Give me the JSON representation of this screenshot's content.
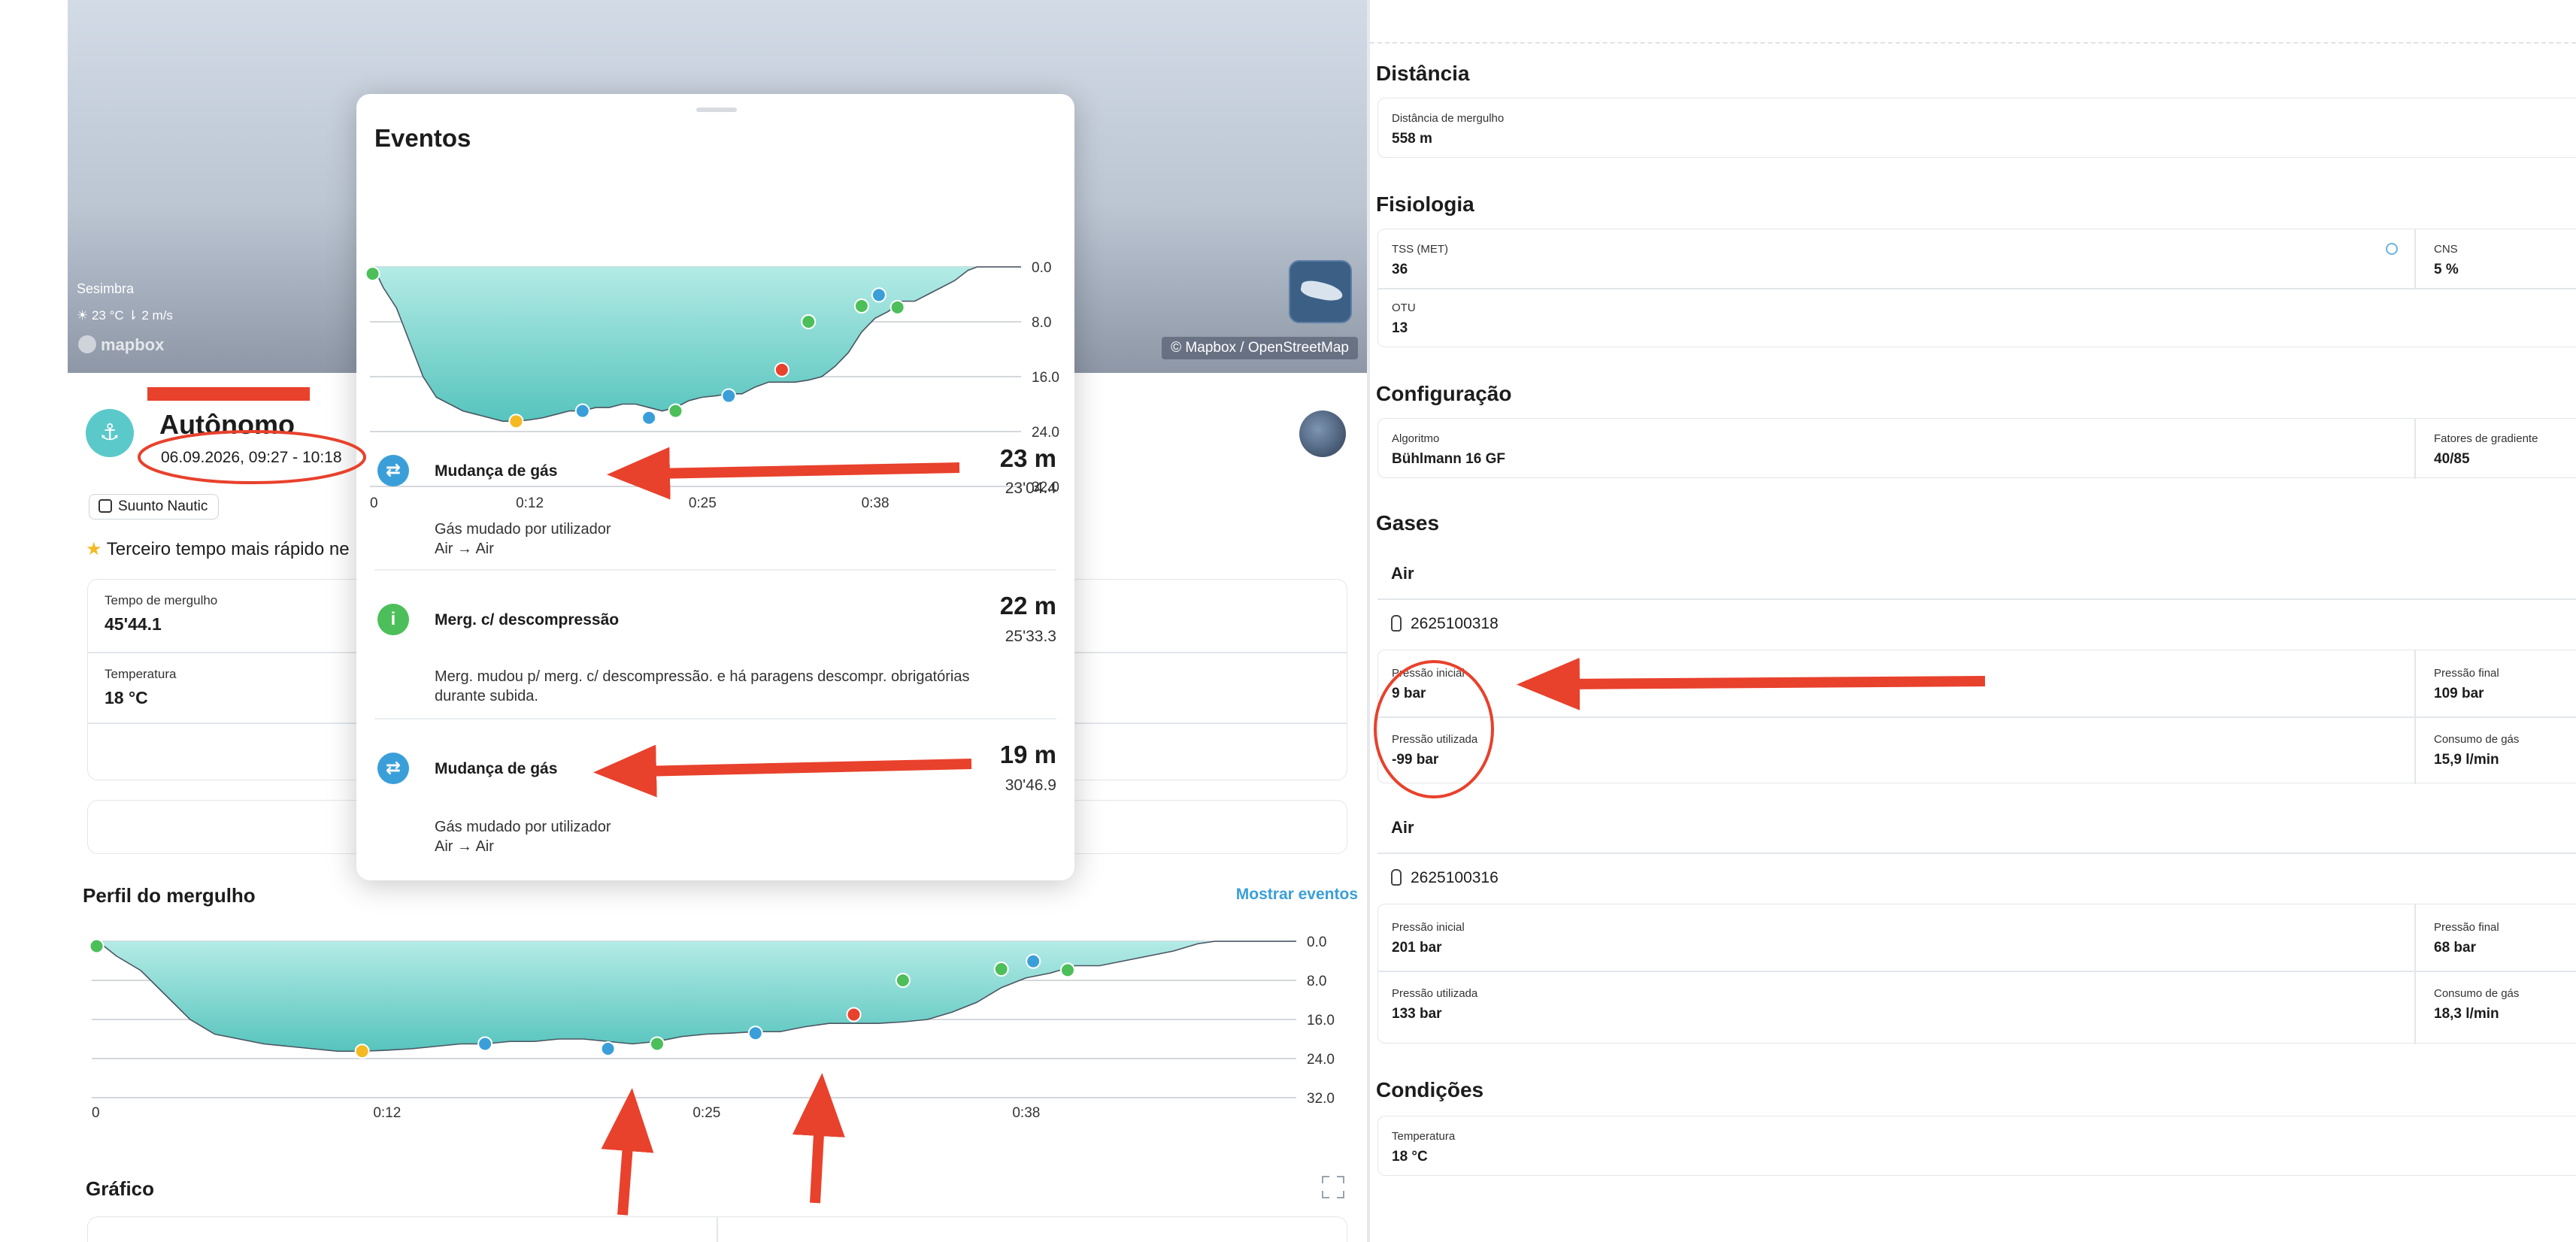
{
  "map": {
    "location": "Sesimbra",
    "weather": "☀ 23 °C  ⇂ 2 m/s",
    "logo": "mapbox",
    "attribution": "© Mapbox / OpenStreetMap"
  },
  "activity": {
    "title": "Autônomo",
    "datetime": "06.09.2026, 09:27 - 10:18",
    "device": "Suunto Nautic",
    "achievement": "Terceiro tempo mais rápido ne"
  },
  "stats": [
    {
      "label": "Tempo de mergulho",
      "value": "45'44.1"
    },
    {
      "label": "Temperatura",
      "value": "18 °C"
    }
  ],
  "profile": {
    "title": "Perfil do mergulho",
    "show_events": "Mostrar eventos",
    "y_ticks": [
      "0.0",
      "8.0",
      "16.0",
      "24.0",
      "32.0"
    ],
    "x_ticks": [
      "0",
      "0:12",
      "0:25",
      "0:38"
    ]
  },
  "graph_title": "Gráfico",
  "chart_data": {
    "type": "area",
    "x_unit": "minutes",
    "y_unit": "m (depth, inverted axis)",
    "ylim": [
      0,
      32
    ],
    "y_ticks": [
      0,
      8,
      16,
      24,
      32
    ],
    "x_ticks": [
      "0",
      "0:12",
      "0:25",
      "0:38"
    ],
    "x": [
      0,
      0.5,
      1,
      2,
      3,
      4,
      5,
      6,
      7,
      8,
      9,
      10,
      11,
      12,
      13,
      14,
      15,
      16,
      17,
      18,
      19,
      20,
      21,
      22,
      23,
      24,
      25,
      26,
      27,
      28,
      29,
      30,
      31,
      32,
      33,
      34,
      35,
      36,
      37,
      38,
      39,
      40,
      41,
      42,
      43,
      44,
      45,
      45.7,
      49
    ],
    "depth": [
      1,
      1,
      3,
      6,
      11,
      16,
      19,
      20,
      21,
      21.5,
      22,
      22.5,
      22.5,
      22.3,
      22,
      21.5,
      21,
      21,
      20.5,
      20.5,
      20,
      20,
      20.5,
      21,
      20.5,
      19.5,
      19,
      18.8,
      18.5,
      18.5,
      17.5,
      16.8,
      16.8,
      16.8,
      16.5,
      16,
      14.5,
      12.5,
      9.5,
      7.5,
      6.5,
      5,
      5,
      4,
      3,
      2,
      0.5,
      0,
      0
    ],
    "events": [
      {
        "x": 0.2,
        "depth": 1,
        "type": "start",
        "color": "#4cbf5a"
      },
      {
        "x": 11,
        "depth": 22.5,
        "type": "warning",
        "color": "#f5b922"
      },
      {
        "x": 16,
        "depth": 21,
        "type": "gas",
        "color": "#3a9fd9"
      },
      {
        "x": 21,
        "depth": 22,
        "type": "gas",
        "color": "#3a9fd9"
      },
      {
        "x": 23,
        "depth": 21,
        "type": "info",
        "color": "#4cbf5a"
      },
      {
        "x": 27,
        "depth": 18.8,
        "type": "gas",
        "color": "#3a9fd9"
      },
      {
        "x": 31,
        "depth": 15,
        "type": "alarm",
        "color": "#e8412c"
      },
      {
        "x": 33,
        "depth": 8,
        "type": "info",
        "color": "#4cbf5a"
      },
      {
        "x": 37,
        "depth": 5.7,
        "type": "info",
        "color": "#4cbf5a"
      },
      {
        "x": 38.3,
        "depth": 4.1,
        "type": "gas",
        "color": "#3a9fd9"
      },
      {
        "x": 39.7,
        "depth": 5.9,
        "type": "info",
        "color": "#4cbf5a"
      }
    ]
  },
  "events_modal": {
    "title": "Eventos",
    "items": [
      {
        "icon": "⇄",
        "color": "#3a9fd9",
        "title": "Mudança de gás",
        "depth": "23 m",
        "time": "23'04.4",
        "desc": "Gás mudado por utilizador\nAir → Air"
      },
      {
        "icon": "i",
        "color": "#4cbf5a",
        "title": "Merg. c/ descompressão",
        "depth": "22 m",
        "time": "25'33.3",
        "desc": "Merg. mudou p/ merg. c/ descompressão. e há paragens descompr. obrigatórias durante subida."
      },
      {
        "icon": "⇄",
        "color": "#3a9fd9",
        "title": "Mudança de gás",
        "depth": "19 m",
        "time": "30'46.9",
        "desc": "Gás mudado por utilizador\nAir → Air"
      }
    ]
  },
  "right": {
    "distance": {
      "title": "Distância",
      "label": "Distância de mergulho",
      "value": "558 m"
    },
    "physiology": {
      "title": "Fisiologia",
      "tss_label": "TSS (MET)",
      "tss_value": "36",
      "cns_label": "CNS",
      "cns_value": "5 %",
      "otu_label": "OTU",
      "otu_value": "13"
    },
    "config": {
      "title": "Configuração",
      "algo_label": "Algoritmo",
      "algo_value": "Bühlmann 16 GF",
      "gf_label": "Fatores de gradiente",
      "gf_value": "40/85"
    },
    "gases": {
      "title": "Gases",
      "tanks": [
        {
          "name": "Air",
          "tank_id": "2625100318",
          "start_label": "Pressão inicial",
          "start": "9 bar",
          "end_label": "Pressão final",
          "end": "109 bar",
          "used_label": "Pressão utilizada",
          "used": "-99 bar",
          "cons_label": "Consumo de gás",
          "cons": "15,9 l/min"
        },
        {
          "name": "Air",
          "tank_id": "2625100316",
          "start_label": "Pressão inicial",
          "start": "201 bar",
          "end_label": "Pressão final",
          "end": "68 bar",
          "used_label": "Pressão utilizada",
          "used": "133 bar",
          "cons_label": "Consumo de gás",
          "cons": "18,3 l/min"
        }
      ]
    },
    "conditions": {
      "title": "Condições",
      "temp_label": "Temperatura",
      "temp_value": "18 °C"
    }
  }
}
